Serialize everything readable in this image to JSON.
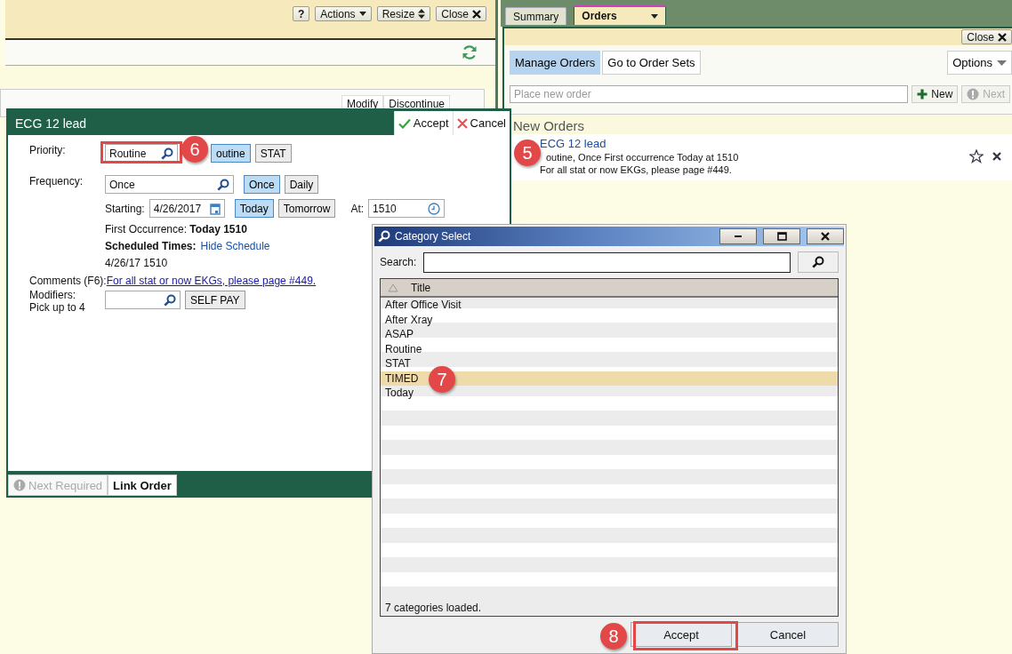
{
  "header_toolbar": {
    "buttons": [
      {
        "label": "?",
        "kind": "help"
      },
      {
        "label": "Actions",
        "kind": "menu"
      },
      {
        "label": "Resize",
        "kind": "resize"
      },
      {
        "label": "Close",
        "kind": "close"
      }
    ]
  },
  "order_list_header": {
    "columns": [
      "Modify",
      "Discontinue"
    ]
  },
  "tabs": [
    {
      "label": "Summary",
      "selected": false
    },
    {
      "label": "Orders",
      "selected": true
    }
  ],
  "orders_panel": {
    "close_label": "Close",
    "views": [
      {
        "label": "Manage Orders",
        "selected": true
      },
      {
        "label": "Go to Order Sets",
        "selected": false
      }
    ],
    "options_label": "Options",
    "order_field": {
      "placeholder": "Place new order"
    },
    "new_button": {
      "label": "New",
      "disabled": false
    },
    "next_button": {
      "label": "Next",
      "disabled": true
    },
    "section_title": "New Orders",
    "orders": [
      {
        "name": "ECG 12 lead",
        "details": "outine, Once First occurrence Today at 1510",
        "comment": "For all stat or now EKGs, please page #449."
      }
    ]
  },
  "order_form": {
    "title": "ECG 12 lead",
    "accept_label": "Accept",
    "cancel_label": "Cancel",
    "priority": {
      "label": "Priority:",
      "value": "Routine",
      "options": [
        {
          "label": "outine",
          "selected": true
        },
        {
          "label": "STAT",
          "selected": false
        }
      ]
    },
    "frequency": {
      "label": "Frequency:",
      "value": "Once",
      "options": [
        {
          "label": "Once",
          "selected": true
        },
        {
          "label": "Daily",
          "selected": false
        }
      ]
    },
    "starting": {
      "label": "Starting:",
      "value": "4/26/2017",
      "options": [
        {
          "label": "Today",
          "selected": true
        },
        {
          "label": "Tomorrow",
          "selected": false
        }
      ],
      "at_label": "At:",
      "at_value": "1510"
    },
    "first_occurrence": {
      "label": "First Occurrence:",
      "value": "Today 1510"
    },
    "scheduled_times": {
      "label": "Scheduled Times:",
      "link": "Hide Schedule",
      "value": "4/26/17 1510"
    },
    "comments": {
      "label": "Comments (F6):",
      "link": "For all stat or now EKGs, please page #449."
    },
    "modifiers": {
      "label": "Modifiers:",
      "hint": "Pick up to 4",
      "options": [
        {
          "label": "SELF PAY",
          "selected": false
        }
      ]
    },
    "footer_buttons": [
      {
        "label": "Next Required",
        "disabled": true
      },
      {
        "label": "Link Order",
        "disabled": false
      }
    ]
  },
  "category_dialog": {
    "title": "Category Select",
    "search_label": "Search:",
    "column": "Title",
    "rows": [
      {
        "label": "After Office Visit",
        "selected": false
      },
      {
        "label": "After Xray",
        "selected": false
      },
      {
        "label": "ASAP",
        "selected": false
      },
      {
        "label": "Routine",
        "selected": false
      },
      {
        "label": "STAT",
        "selected": false
      },
      {
        "label": "TIMED",
        "selected": true
      },
      {
        "label": "Today",
        "selected": false
      }
    ],
    "status": "7 categories loaded.",
    "buttons": [
      "Accept",
      "Cancel"
    ]
  },
  "callouts": [
    {
      "label": "5"
    },
    {
      "label": "6"
    },
    {
      "label": "7"
    },
    {
      "label": "8"
    }
  ]
}
